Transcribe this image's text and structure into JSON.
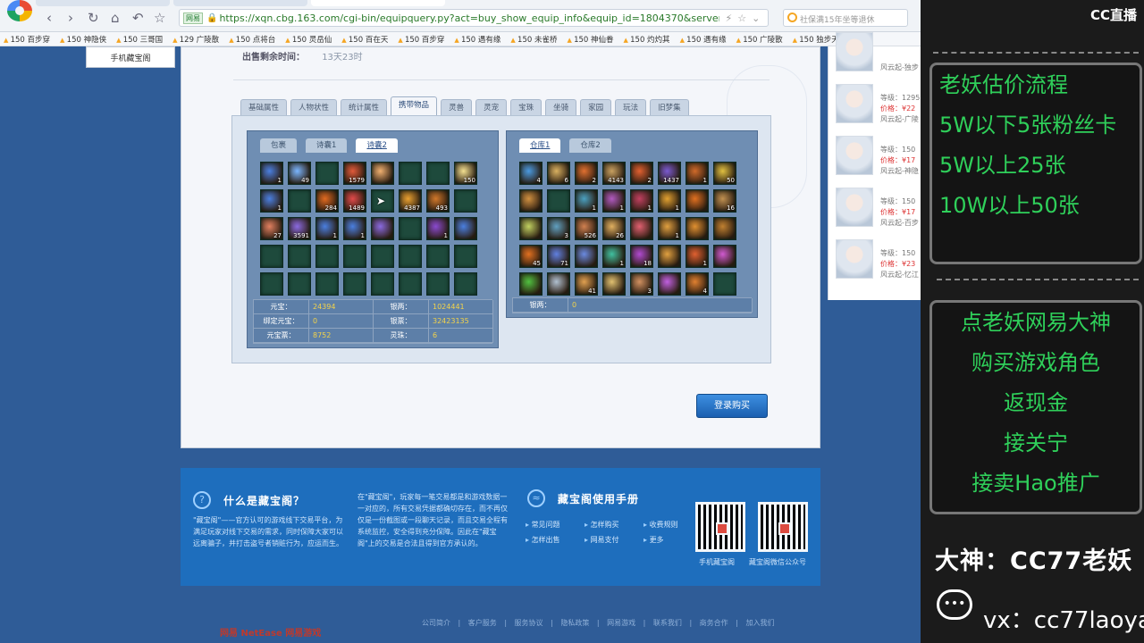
{
  "browser": {
    "verified_label": "网易",
    "url": "https://xqn.cbg.163.com/cgi-bin/equipquery.py?act=buy_show_equip_info&equip_id=1804370&server_ic",
    "search_placeholder": "社保满15年坐等退休"
  },
  "bookmarks": [
    "150 百步穿",
    "150 神隐侠",
    "150 三哥国",
    "129 广陵散",
    "150 点将台",
    "150 灵岳仙",
    "150 百在天",
    "150 百步穿",
    "150 遇有缘",
    "150 未雀桥",
    "150 神仙眷",
    "150 灼灼其",
    "150 遇有缘",
    "150 广陵散",
    "150 独步天",
    "15"
  ],
  "mobile_link": "手机藏宝阁",
  "sale": {
    "label": "出售剩余时间：",
    "value": "13天23时"
  },
  "tabs": [
    "基础属性",
    "人物状性",
    "统计属性",
    "携带物品",
    "灵兽",
    "灵宠",
    "宝珠",
    "坐骑",
    "家园",
    "玩法",
    "旧梦集"
  ],
  "bag": {
    "tabs": [
      "包裹",
      "诗囊1",
      "诗囊2"
    ],
    "items": [
      {
        "c": "#4a7fe0",
        "q": "1"
      },
      {
        "c": "#7ab6ff",
        "q": "49"
      },
      {},
      {
        "c": "#e05a3a",
        "q": "1579"
      },
      {
        "c": "#f0b070",
        "q": ""
      },
      {},
      {},
      {
        "c": "#f3e090",
        "q": "150"
      },
      {
        "c": "#4a7fe0",
        "q": "1"
      },
      {},
      {
        "c": "#e06a20",
        "q": "284"
      },
      {
        "c": "#e04a4a",
        "q": "1489"
      },
      {},
      {
        "c": "#e8a030",
        "q": "4387"
      },
      {
        "c": "#d0782a",
        "q": "493"
      },
      {},
      {
        "c": "#e08060",
        "q": "27"
      },
      {
        "c": "#8a6ae0",
        "q": "3591"
      },
      {
        "c": "#4a7fe0",
        "q": "1"
      },
      {
        "c": "#4a7fe0",
        "q": "1"
      },
      {
        "c": "#8a6ae0",
        "q": ""
      },
      {},
      {
        "c": "#8a4ad0",
        "q": "1"
      },
      {
        "c": "#4a7fe0",
        "q": ""
      },
      {},
      {},
      {},
      {},
      {},
      {},
      {},
      {},
      {},
      {},
      {},
      {},
      {},
      {},
      {},
      {}
    ],
    "info": [
      [
        "元宝：",
        "24394",
        "银两：",
        "1024441"
      ],
      [
        "绑定元宝：",
        "0",
        "银票：",
        "32423135"
      ],
      [
        "元宝票：",
        "8752",
        "灵珠：",
        "6"
      ]
    ]
  },
  "warehouse": {
    "tabs": [
      "仓库1",
      "仓库2"
    ],
    "items": [
      {
        "c": "#4a9ae0",
        "q": "4"
      },
      {
        "c": "#d8b060",
        "q": "6"
      },
      {
        "c": "#e07030",
        "q": "2"
      },
      {
        "c": "#c8a060",
        "q": "4143"
      },
      {
        "c": "#e06030",
        "q": "2"
      },
      {
        "c": "#7a5ad0",
        "q": "1437"
      },
      {
        "c": "#d06a2a",
        "q": "1"
      },
      {
        "c": "#e0c040",
        "q": "50"
      },
      {
        "c": "#d09040",
        "q": ""
      },
      {},
      {
        "c": "#4aa0c0",
        "q": "1"
      },
      {
        "c": "#b05ac0",
        "q": "1"
      },
      {
        "c": "#c04060",
        "q": "1"
      },
      {
        "c": "#e0a030",
        "q": "1"
      },
      {
        "c": "#e07020",
        "q": ""
      },
      {
        "c": "#c09050",
        "q": "16"
      },
      {
        "c": "#c0d060",
        "q": ""
      },
      {
        "c": "#60a0c0",
        "q": "3"
      },
      {
        "c": "#d08050",
        "q": "526"
      },
      {
        "c": "#e0b060",
        "q": "26"
      },
      {
        "c": "#e06070",
        "q": ""
      },
      {
        "c": "#e0a040",
        "q": "1"
      },
      {
        "c": "#e09030",
        "q": ""
      },
      {
        "c": "#c08030",
        "q": ""
      },
      {
        "c": "#e07020",
        "q": "45"
      },
      {
        "c": "#6080e0",
        "q": "71"
      },
      {
        "c": "#6a8ae0",
        "q": ""
      },
      {
        "c": "#40c0a0",
        "q": "1"
      },
      {
        "c": "#b04ad0",
        "q": "18"
      },
      {
        "c": "#e0a040",
        "q": ""
      },
      {
        "c": "#e06030",
        "q": "1"
      },
      {
        "c": "#d05ad0",
        "q": ""
      },
      {
        "c": "#50c040",
        "q": ""
      },
      {
        "c": "#b0c0d0",
        "q": ""
      },
      {
        "c": "#e0a050",
        "q": "41"
      },
      {
        "c": "#e0c070",
        "q": ""
      },
      {
        "c": "#d09060",
        "q": "3"
      },
      {
        "c": "#c060e0",
        "q": ""
      },
      {
        "c": "#e08030",
        "q": "4"
      },
      {}
    ],
    "info": [
      [
        "银两：",
        "0"
      ]
    ]
  },
  "buy_button": "登录购买",
  "footer": {
    "what_title": "什么是藏宝阁？",
    "what_text": "\"藏宝阁\"——官方认可的游戏线下交易平台，为满足玩家对线下交易的需求，同时保障大家可以远离骗子，并打击盗号者销赃行为，应运而生。",
    "mid_text": "在\"藏宝阁\"，玩家每一笔交易都是和游戏数据一一对应的，所有交易凭据都确切存在，而不再仅仅是一份截图或一段聊天记录，而且交易全程有系统监控，安全得到充分保障。因此在\"藏宝阁\"上的交易是合法且得到官方承认的。",
    "manual_title": "藏宝阁使用手册",
    "links": [
      "常见问题",
      "怎样购买",
      "收费规则",
      "怎样出售",
      "网易支付",
      "更多"
    ],
    "qr_labels": [
      "手机藏宝阁",
      "藏宝阁微信公众号"
    ]
  },
  "bottom_links": "公司简介 | 客户服务 | 服务协议 | 隐私政策 | 网易游戏 | 联系我们 | 商务合作 | 加入我们",
  "netease_logo": "网易 NetEase 网易游戏",
  "sellers": [
    {
      "level": "",
      "price": "",
      "server": "风云起-独步"
    },
    {
      "level": "等级：1295",
      "price": "价格：¥22",
      "server": "风云起-广陵"
    },
    {
      "level": "等级：150",
      "price": "价格：¥17",
      "server": "风云起-神隐"
    },
    {
      "level": "等级：150",
      "price": "价格：¥17",
      "server": "风云起-百步"
    },
    {
      "level": "等级：150",
      "price": "价格：¥23",
      "server": "风云起-忆江"
    }
  ],
  "stream": {
    "logo": "CC直播",
    "box1": [
      "老妖估价流程",
      "5W以下5张粉丝卡",
      "5W以上25张",
      "10W以上50张"
    ],
    "box2": [
      "点老妖网易大神",
      "购买游戏角色",
      "返现金",
      "接关宁",
      "接卖Hao推广"
    ],
    "name": "大神：CC77老妖",
    "vx": "vx：cc77laoyao"
  }
}
